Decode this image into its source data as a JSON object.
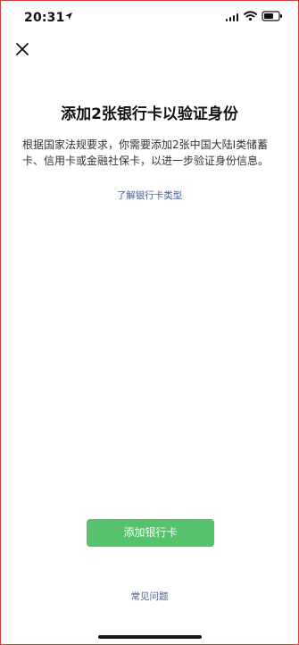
{
  "status_bar": {
    "time": "20:31",
    "icons": [
      "location-arrow-icon",
      "signal-icon",
      "wifi-icon",
      "battery-icon"
    ]
  },
  "page": {
    "title": "添加2张银行卡以验证身份",
    "description": "根据国家法规要求，你需要添加2张中国大陆Ⅰ类储蓄卡、信用卡或金融社保卡，以进一步验证身份信息。",
    "learn_link": "了解银行卡类型",
    "primary_button": "添加银行卡",
    "faq_link": "常见问题"
  },
  "colors": {
    "primary_button": "#56c26b",
    "link": "#4b5f8a"
  }
}
